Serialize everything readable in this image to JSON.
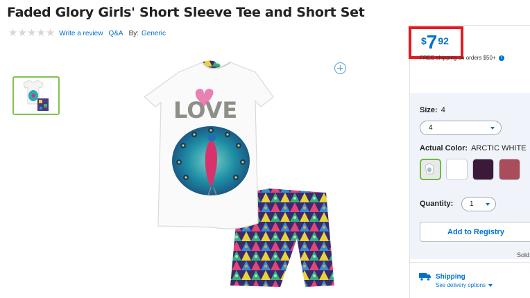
{
  "product": {
    "title": "Faded Glory Girls' Short Sleeve Tee and Short Set",
    "rating_stars": 0,
    "write_review": "Write a review",
    "qa": "Q&A",
    "by_label": "By:",
    "brand": "Generic",
    "image_text": "LOVE"
  },
  "price": {
    "dollar_sign": "$",
    "dollars": "7",
    "cents": "92",
    "free_shipping": "FREE shipping on orders $50+",
    "info_icon": "i"
  },
  "options": {
    "size_label": "Size:",
    "size_value": "4",
    "size_select": "4",
    "color_label": "Actual Color:",
    "color_value": "ARCTIC WHITE",
    "swatches": [
      {
        "name": "Arctic White print",
        "color": "#e6e6e6",
        "selected": true
      },
      {
        "name": "White",
        "color": "#ffffff",
        "selected": false
      },
      {
        "name": "Dark Purple",
        "color": "#3a1a38",
        "selected": false
      },
      {
        "name": "Rose",
        "color": "#a94d5b",
        "selected": false
      }
    ],
    "quantity_label": "Quantity:",
    "quantity_value": "1"
  },
  "actions": {
    "registry": "Add to Registry",
    "sold": "Sold"
  },
  "shipping": {
    "label": "Shipping",
    "options": "See delivery options"
  },
  "colors": {
    "accent": "#0071ce",
    "price_highlight": "#e11b22",
    "selected_border": "#6dbb45"
  }
}
